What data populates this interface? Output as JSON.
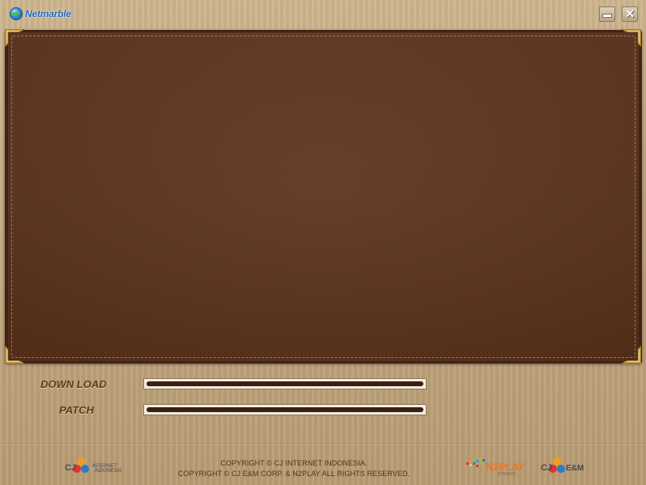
{
  "titlebar": {
    "logo_text": "Netmarble",
    "logo_icon": "netmarble-globe-icon",
    "minimize_icon": "minimize-icon",
    "close_icon": "close-icon",
    "close_glyph": "✕"
  },
  "progress": {
    "download": {
      "label": "DOWN LOAD",
      "fraction": 0.0
    },
    "patch": {
      "label": "PATCH",
      "fraction": 0.0
    }
  },
  "footer": {
    "copyright_line1": "COPYRIGHT © CJ INTERNET INDONESIA.",
    "copyright_line2": "COPYRIGHT © CJ E&M CORP. & N2PLAY ALL RIGHTS RESERVED.",
    "cj_internet": {
      "word": "CJ",
      "sub1": "INTERNET",
      "sub2": "INDONESIA"
    },
    "n2play": {
      "word": "N2PLAY",
      "sub": "STUDIO"
    },
    "cj_enm": {
      "word": "CJ",
      "sub": "E&M"
    }
  },
  "colors": {
    "leather": "#5d3520",
    "wood": "#c4a982",
    "n2play_orange": "#e9762a",
    "cj_red": "#e0342f",
    "cj_orange": "#f39b1f",
    "cj_blue": "#2c7cc4"
  }
}
